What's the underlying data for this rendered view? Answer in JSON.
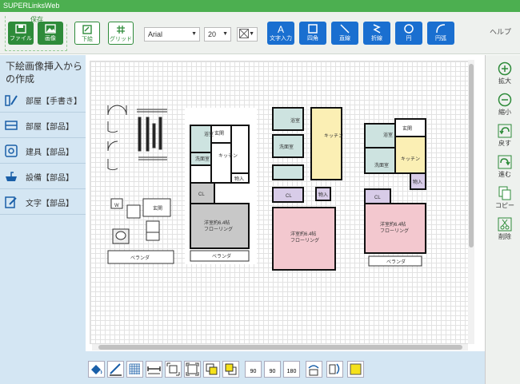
{
  "app": {
    "title": "SUPERLinksWeb"
  },
  "toolbar": {
    "save_group_label": "保存",
    "file_button": "ファイル",
    "image_button": "画像",
    "underlay_button": "下絵",
    "grid_button": "グリッド",
    "font_select": "Arial",
    "size_select": "20",
    "text_input_button": "文字入力",
    "square_button": "四角",
    "line_button": "直線",
    "polyline_button": "折線",
    "circle_button": "円",
    "arc_button": "円弧",
    "help_link": "ヘルプ"
  },
  "sidebar": {
    "title": "下絵画像挿入からの作成",
    "items": [
      {
        "label": "部屋【手書き】",
        "icon": "pencil-ruler-icon"
      },
      {
        "label": "部屋【部品】",
        "icon": "floor-icon"
      },
      {
        "label": "建具【部品】",
        "icon": "door-icon"
      },
      {
        "label": "設備【部品】",
        "icon": "sink-icon"
      },
      {
        "label": "文字【部品】",
        "icon": "edit-text-icon"
      }
    ]
  },
  "canvas": {
    "labels": {
      "bath": "浴室",
      "kitchen": "キッチン",
      "washroom": "洗面室",
      "entrance": "玄関",
      "closet": "CL",
      "storage": "物入",
      "balcony": "ベランダ",
      "western_room": "洋室約6.4帖",
      "flooring": "フローリング",
      "w": "W"
    }
  },
  "right_tools": [
    {
      "label": "拡大",
      "icon": "zoom-in-icon"
    },
    {
      "label": "縮小",
      "icon": "zoom-out-icon"
    },
    {
      "label": "戻す",
      "icon": "undo-icon"
    },
    {
      "label": "進む",
      "icon": "redo-icon"
    },
    {
      "label": "コピー",
      "icon": "copy-icon"
    },
    {
      "label": "削除",
      "icon": "delete-icon"
    }
  ],
  "bottom_tools": {
    "rotate_90_left": "90",
    "rotate_90_right": "90",
    "rotate_180": "180"
  },
  "colors": {
    "brand_green": "#4caf50",
    "button_green": "#2e8b3a",
    "button_blue": "#1a6fd0",
    "sidebar_bg": "#d4e6f3",
    "room_grey": "#c8c8c8",
    "room_teal": "#cde3e0",
    "room_yellow": "#fbefb4",
    "room_purple": "#d8cce8",
    "room_pink": "#f3c8cf"
  }
}
